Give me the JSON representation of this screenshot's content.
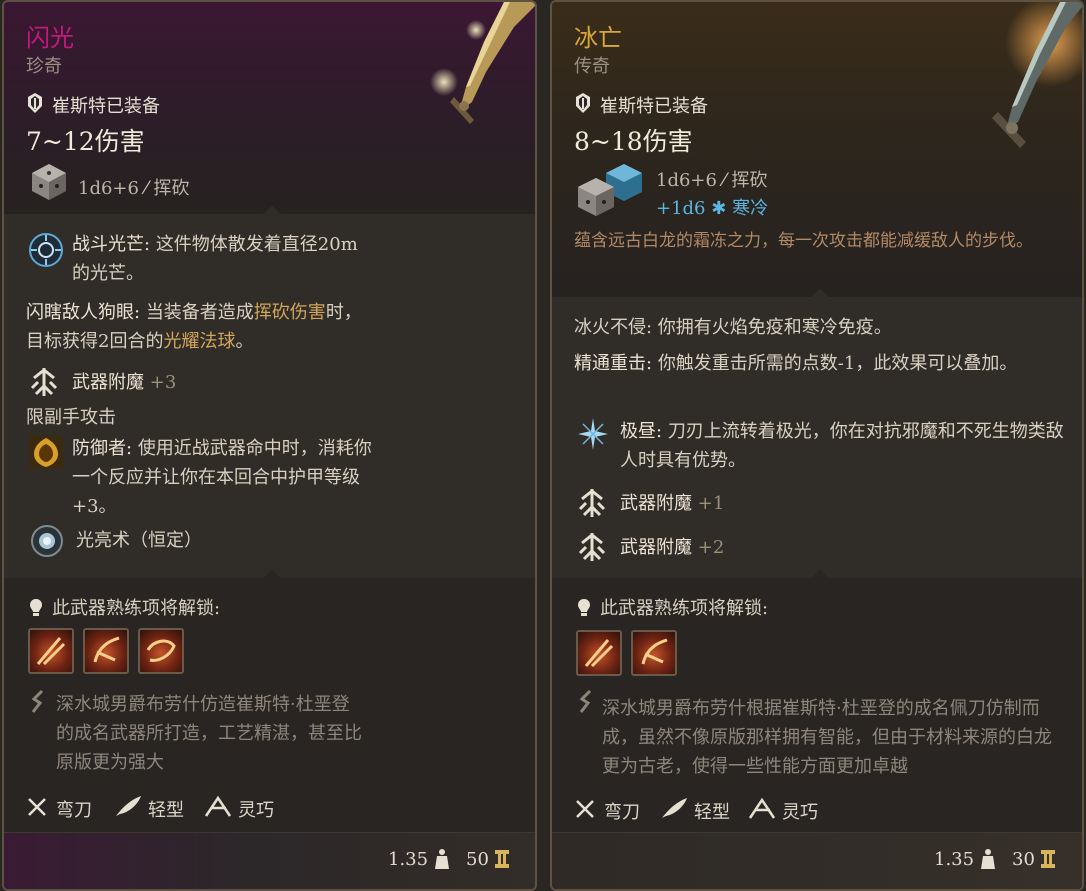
{
  "cards": [
    {
      "name": "闪光",
      "rarity": "珍奇",
      "name_color": "#c4187f",
      "equipped": "崔斯特已装备",
      "damage": "7~12伤害",
      "dice": {
        "primary": "1d6+6",
        "primary_type": "挥砍"
      },
      "effects": {
        "combat_light_name": "战斗光芒:",
        "combat_light_text": "这件物体散发着直径20m的光芒。",
        "blind_name": "闪瞎敌人狗眼:",
        "blind_text_1": "当装备者造成",
        "blind_text_hl": "挥砍伤害",
        "blind_text_2": "时，目标获得2回合的",
        "blind_text_hl2": "光耀法球",
        "blind_text_3": "。",
        "enchant_label": "武器附魔",
        "enchant_bonus": "+3",
        "offhand": "限副手攻击",
        "defender_name": "防御者:",
        "defender_text": "使用近战武器命中时，消耗你一个反应并让你在本回合中护甲等级+3。",
        "spell": "光亮术（恒定）"
      },
      "proficiency_label": "此武器熟练项将解锁:",
      "description": "深水城男爵布劳什仿造崔斯特·杜垩登的成名武器所打造，工艺精湛，甚至比原版更为强大",
      "tags": [
        "弯刀",
        "轻型",
        "灵巧"
      ],
      "weight": "1.35",
      "value": "50",
      "skills": [
        "skill-slash-icon",
        "skill-flourish-icon",
        "skill-rush-icon"
      ]
    },
    {
      "name": "冰亡",
      "rarity": "传奇",
      "name_color": "#d9a63a",
      "equipped": "崔斯特已装备",
      "damage": "8~18伤害",
      "dice": {
        "primary": "1d6+6",
        "primary_type": "挥砍",
        "secondary": "+1d6",
        "secondary_type": "寒冷"
      },
      "flavor": "蕴含远古白龙的霜冻之力，每一次攻击都能减缓敌人的步伐。",
      "effects": {
        "fire_cold": "冰火不侵: 你拥有火焰免疫和寒冷免疫。",
        "crit_name": "精通重击:",
        "crit_text": "你触发重击所需的点数-1，此效果可以叠加。",
        "aurora_name": "极昼:",
        "aurora_text": "刀刃上流转着极光，你在对抗邪魔和不死生物类敌人时具有优势。",
        "enchant_label": "武器附魔",
        "enchant_bonus_1": "+1",
        "enchant_bonus_2": "+2"
      },
      "proficiency_label": "此武器熟练项将解锁:",
      "description": "深水城男爵布劳什根据崔斯特·杜垩登的成名佩刀仿制而成，虽然不像原版那样拥有智能，但由于材料来源的白龙更为古老，使得一些性能方面更加卓越",
      "tags": [
        "弯刀",
        "轻型",
        "灵巧"
      ],
      "weight": "1.35",
      "value": "30",
      "skills": [
        "skill-slash-icon",
        "skill-flourish-icon"
      ]
    }
  ]
}
